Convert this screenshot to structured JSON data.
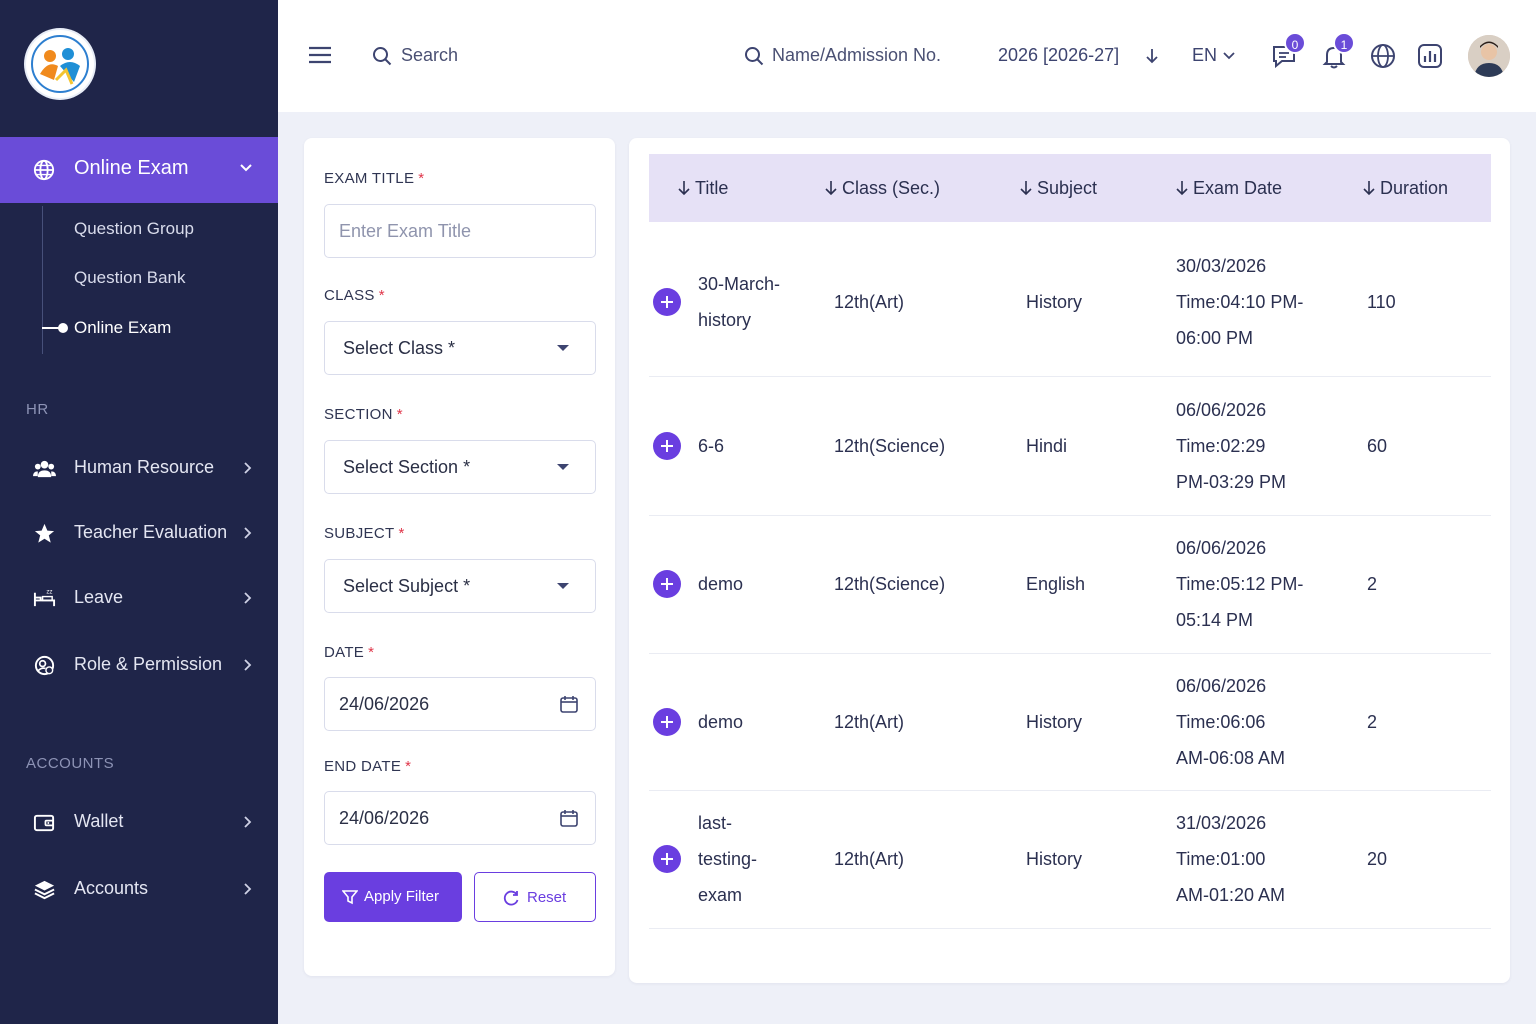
{
  "sidebar": {
    "active_item": "Online Exam",
    "sub_items": [
      "Question Group",
      "Question Bank",
      "Online Exam"
    ],
    "sections": [
      {
        "heading": "HR",
        "items": [
          "Human Resource",
          "Teacher Evaluation",
          "Leave",
          "Role & Permission"
        ]
      },
      {
        "heading": "ACCOUNTS",
        "items": [
          "Wallet",
          "Accounts"
        ]
      }
    ]
  },
  "topbar": {
    "search_label": "Search",
    "name_search_label": "Name/Admission No.",
    "session_label": "2026 [2026-27]",
    "language_label": "EN",
    "messages_badge": "0",
    "notifications_badge": "1"
  },
  "filter": {
    "exam_title_label": "EXAM TITLE",
    "exam_title_placeholder": "Enter Exam Title",
    "class_label": "CLASS",
    "class_value": "Select Class *",
    "section_label": "SECTION",
    "section_value": "Select Section *",
    "subject_label": "SUBJECT",
    "subject_value": "Select Subject *",
    "date_label": "DATE",
    "date_value": "24/06/2026",
    "end_date_label": "END DATE",
    "end_date_value": "24/06/2026",
    "required_mark": "*",
    "apply_label": "Apply Filter",
    "reset_label": "Reset"
  },
  "table": {
    "columns": [
      "Title",
      "Class (Sec.)",
      "Subject",
      "Exam Date",
      "Duration"
    ],
    "rows": [
      {
        "title": [
          "30-March-",
          "history"
        ],
        "class": "12th(Art)",
        "subject": "History",
        "date": [
          "30/03/2026",
          "Time:04:10 PM-",
          "06:00 PM"
        ],
        "duration": "110"
      },
      {
        "title": [
          "6-6"
        ],
        "class": "12th(Science)",
        "subject": "Hindi",
        "date": [
          "06/06/2026",
          "Time:02:29",
          "PM-03:29 PM"
        ],
        "duration": "60"
      },
      {
        "title": [
          "demo"
        ],
        "class": "12th(Science)",
        "subject": "English",
        "date": [
          "06/06/2026",
          "Time:05:12 PM-",
          "05:14 PM"
        ],
        "duration": "2"
      },
      {
        "title": [
          "demo"
        ],
        "class": "12th(Art)",
        "subject": "History",
        "date": [
          "06/06/2026",
          "Time:06:06",
          "AM-06:08 AM"
        ],
        "duration": "2"
      },
      {
        "title": [
          "last-",
          "testing-",
          "exam"
        ],
        "class": "12th(Art)",
        "subject": "History",
        "date": [
          "31/03/2026",
          "Time:01:00",
          "AM-01:20 AM"
        ],
        "duration": "20"
      }
    ]
  }
}
